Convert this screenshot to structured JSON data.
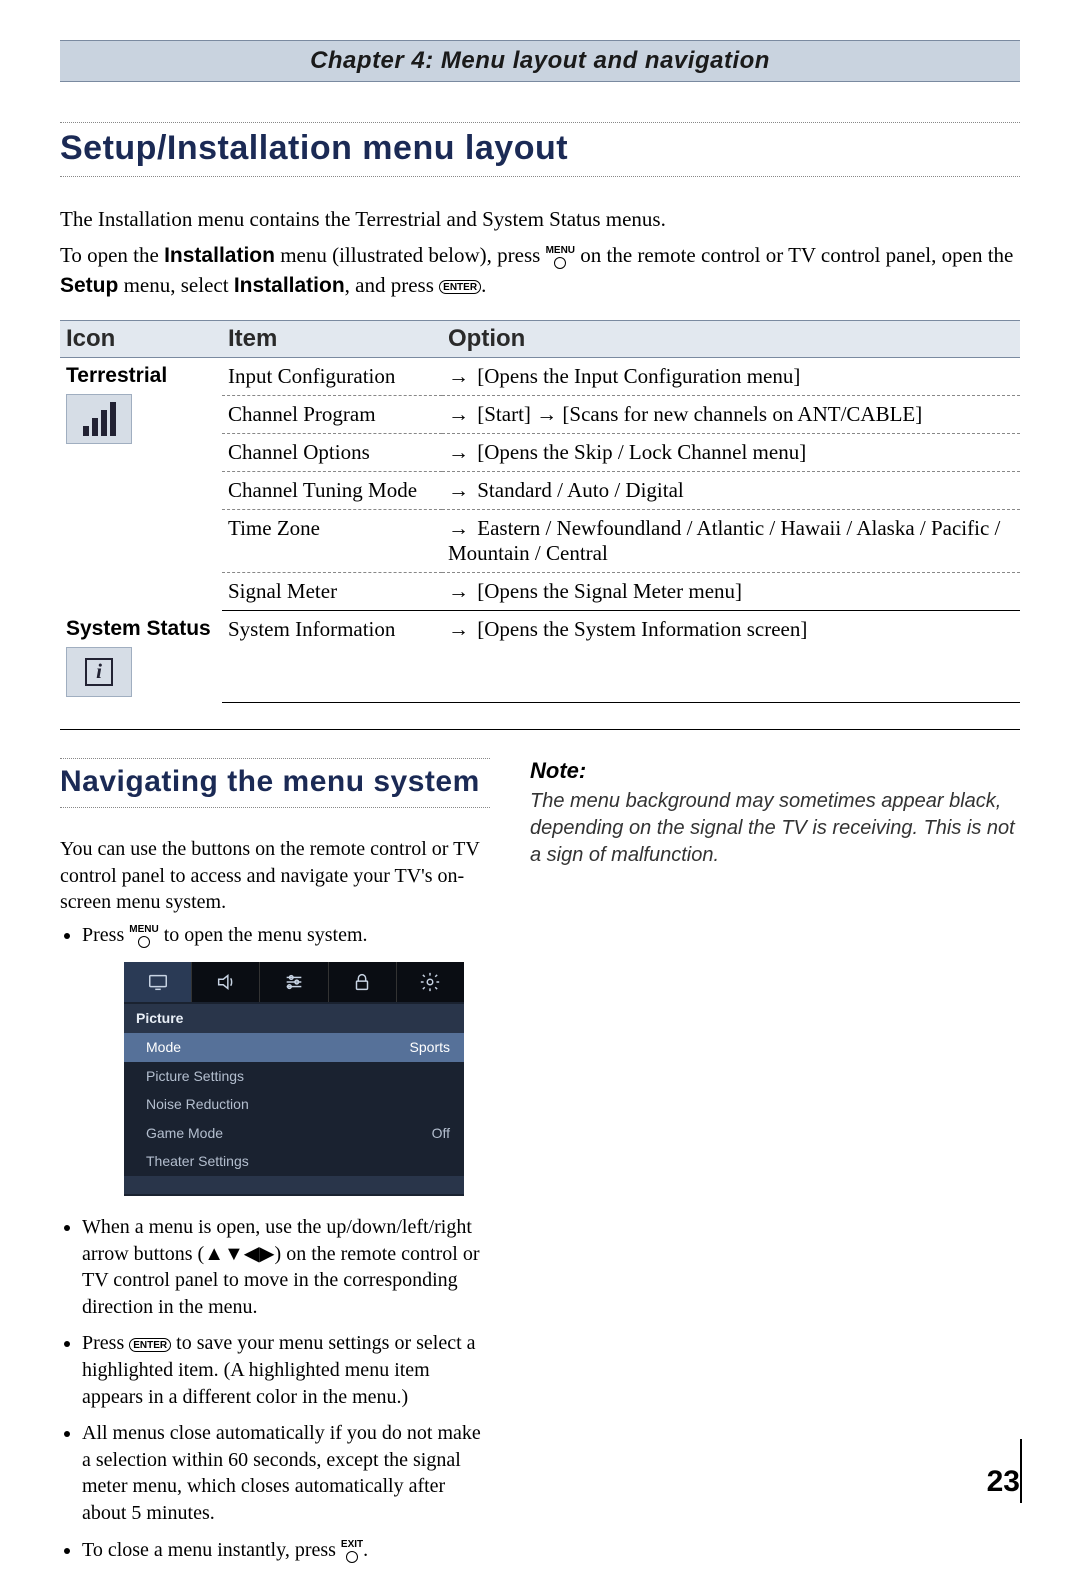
{
  "chapter_banner": "Chapter 4: Menu layout and navigation",
  "section1": {
    "title": "Setup/Installation menu layout",
    "intro_line1": "The Installation menu contains the Terrestrial and System Status menus.",
    "intro_line2_a": "To open the ",
    "intro_line2_b": "Installation",
    "intro_line2_c": " menu (illustrated below), press ",
    "intro_line2_d": " on the remote control or TV control panel, open the ",
    "intro_line3_a": "Setup",
    "intro_line3_b": " menu, select ",
    "intro_line3_c": "Installation",
    "intro_line3_d": ", and press ",
    "intro_line3_e": "."
  },
  "buttons": {
    "menu_label": "MENU",
    "enter_label": "ENTER",
    "exit_label": "EXIT"
  },
  "table": {
    "headers": {
      "icon": "Icon",
      "item": "Item",
      "option": "Option"
    },
    "groups": [
      {
        "label": "Terrestrial",
        "icon": "signal",
        "rows": [
          {
            "item": "Input Configuration",
            "option": "[Opens the Input Configuration menu]"
          },
          {
            "item": "Channel Program",
            "option": "[Start] → [Scans for new channels on ANT/CABLE]"
          },
          {
            "item": "Channel Options",
            "option": "[Opens the Skip / Lock Channel menu]"
          },
          {
            "item": "Channel Tuning Mode",
            "option": "Standard / Auto / Digital"
          },
          {
            "item": "Time Zone",
            "option": "Eastern / Newfoundland / Atlantic / Hawaii / Alaska / Pacific / Mountain / Central"
          },
          {
            "item": "Signal Meter",
            "option": "[Opens the Signal Meter menu]"
          }
        ]
      },
      {
        "label": "System Status",
        "icon": "info",
        "rows": [
          {
            "item": "System Information",
            "option": "[Opens the System Information screen]"
          }
        ]
      }
    ]
  },
  "section2": {
    "title": "Navigating the menu system",
    "intro": "You can use the buttons on the remote control or TV control panel to access and navigate your TV's on-screen menu system.",
    "bullets": {
      "b1_a": "Press ",
      "b1_b": " to open the menu system.",
      "b2": "When a menu is open, use the up/down/left/right arrow buttons (▲▼◀▶) on the remote control or TV control panel to move in the corresponding direction in the menu.",
      "b3_a": "Press ",
      "b3_b": " to save your menu settings or select a highlighted item. (A highlighted menu item appears in a different color in the menu.)",
      "b4": "All menus close automatically if you do not make a selection within 60 seconds, except the signal meter menu, which closes automatically after about 5 minutes.",
      "b5_a": "To close a menu instantly, press ",
      "b5_b": "."
    }
  },
  "osd": {
    "header": "Picture",
    "rows": [
      {
        "label": "Mode",
        "value": "Sports",
        "selected": true
      },
      {
        "label": "Picture Settings",
        "value": "",
        "selected": false
      },
      {
        "label": "Noise Reduction",
        "value": "",
        "selected": false
      },
      {
        "label": "Game Mode",
        "value": "Off",
        "selected": false
      },
      {
        "label": "Theater Settings",
        "value": "",
        "selected": false
      }
    ]
  },
  "note": {
    "title": "Note:",
    "body": "The menu background may sometimes appear black, depending on the signal the TV is receiving. This is not a sign of malfunction."
  },
  "page_number": "23"
}
